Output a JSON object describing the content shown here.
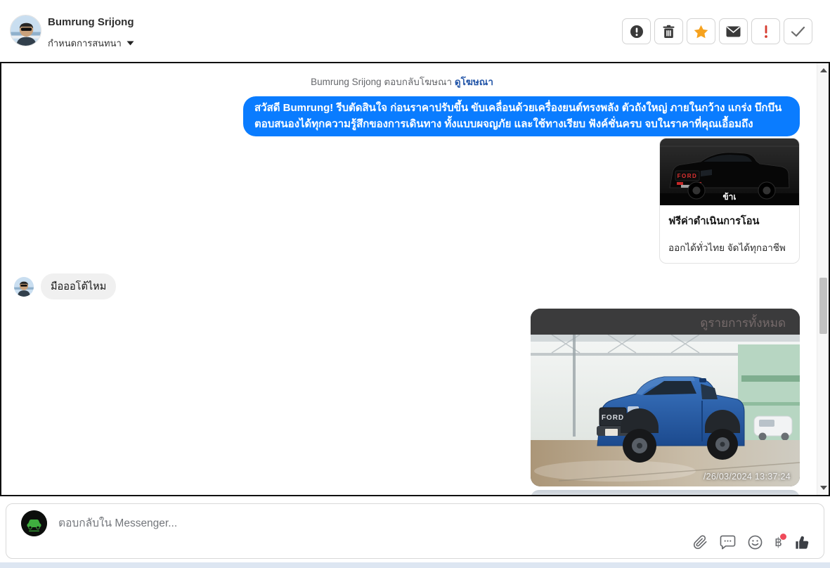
{
  "header": {
    "name": "Bumrung Srijong",
    "conversation_menu": "กำหนดการสนทนา",
    "actions": [
      {
        "id": "report",
        "icon": "exclamation-circle-icon"
      },
      {
        "id": "delete",
        "icon": "trash-icon"
      },
      {
        "id": "favorite",
        "icon": "star-icon"
      },
      {
        "id": "message",
        "icon": "envelope-icon"
      },
      {
        "id": "important",
        "icon": "exclamation-icon"
      },
      {
        "id": "done",
        "icon": "check-icon"
      }
    ]
  },
  "chat": {
    "context": {
      "prefix": "Bumrung Srijong ตอบกลับโฆษณา",
      "link": "ดูโฆษณา"
    },
    "outgoing": {
      "text": "สวัสดี Bumrung! รีบตัดสินใจ ก่อนราคาปรับขึ้น ขับเคลื่อนด้วยเครื่องยนต์ทรงพลัง ตัวถังใหญ่ ภายในกว้าง แกร่ง บึกบึน ตอบสนองได้ทุกความรู้สึกของการเดินทาง ทั้งแบบผจญภัย และใช้ทางเรียบ ฟังค์ชั่นครบ จบในราคาที่คุณเอื้อมถึง"
    },
    "card": {
      "title": "ฟรีค่าดำเนินการโอน",
      "subtitle": "ออกได้ทั่วไทย จัดได้ทุกอาชีพ",
      "brand": "FORD",
      "watermark": "ข้าเ"
    },
    "incoming": {
      "text": "มือออโต้ไหม"
    },
    "photo": {
      "overlay": "ดูรายการทั้งหมด",
      "brand": "FORD",
      "timestamp": "/26/03/2024 13:37:24"
    }
  },
  "composer": {
    "placeholder": "ตอบกลับใน Messenger...",
    "baht_symbol": "฿",
    "icons": [
      "paperclip-icon",
      "comment-icon",
      "smiley-icon",
      "baht-icon",
      "thumbs-up-icon"
    ]
  },
  "colors": {
    "bubble_blue": "#0a7cff",
    "link_blue": "#2456a8",
    "star_orange": "#f6a21e",
    "alert_red": "#d63b2f",
    "notification_dot": "#ef4a5a",
    "bottom_strip": "#dde6f2"
  }
}
